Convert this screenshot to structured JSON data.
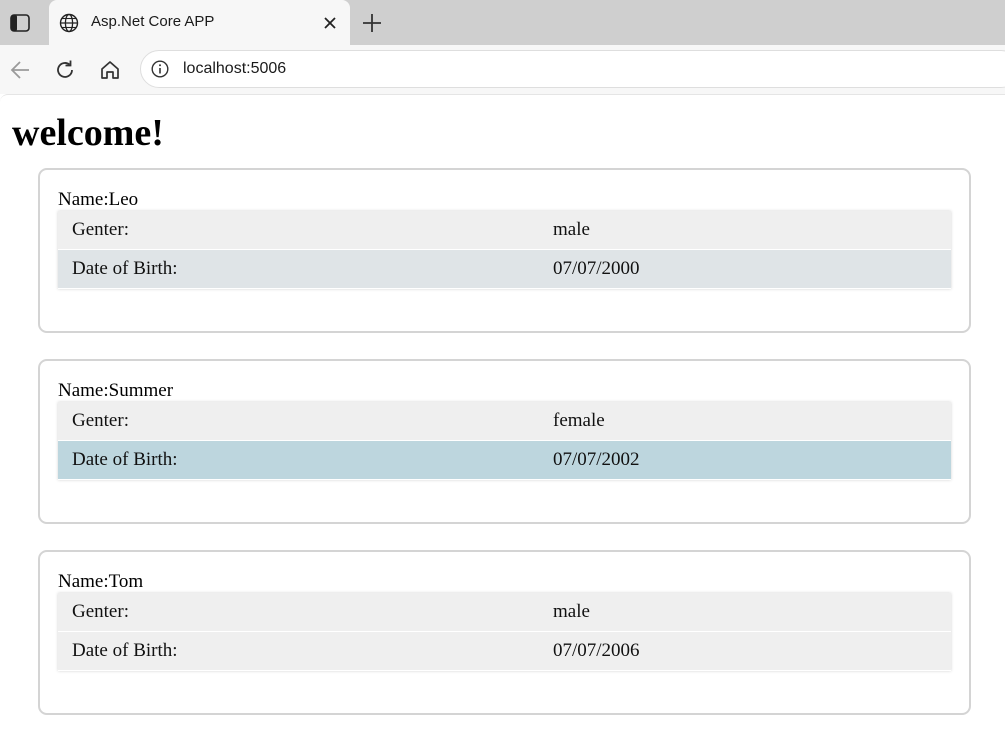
{
  "browser": {
    "tab_title": "Asp.Net Core APP",
    "url": "localhost:5006"
  },
  "page": {
    "title": "welcome!",
    "people": [
      {
        "name": "Name:Leo",
        "gender_label": "Genter:",
        "gender": "male",
        "dob_label": "Date of Birth:",
        "dob": "07/07/2000"
      },
      {
        "name": "Name:Summer",
        "gender_label": "Genter:",
        "gender": "female",
        "dob_label": "Date of Birth:",
        "dob": "07/07/2002"
      },
      {
        "name": "Name:Tom",
        "gender_label": "Genter:",
        "gender": "male",
        "dob_label": "Date of Birth:",
        "dob": "07/07/2006"
      }
    ]
  },
  "colors": {
    "tabstrip": "#cfcfcf",
    "row_default": "#efefef",
    "row_hover_light": "#dfe4e7",
    "row_hover_blue": "#bdd6de"
  }
}
